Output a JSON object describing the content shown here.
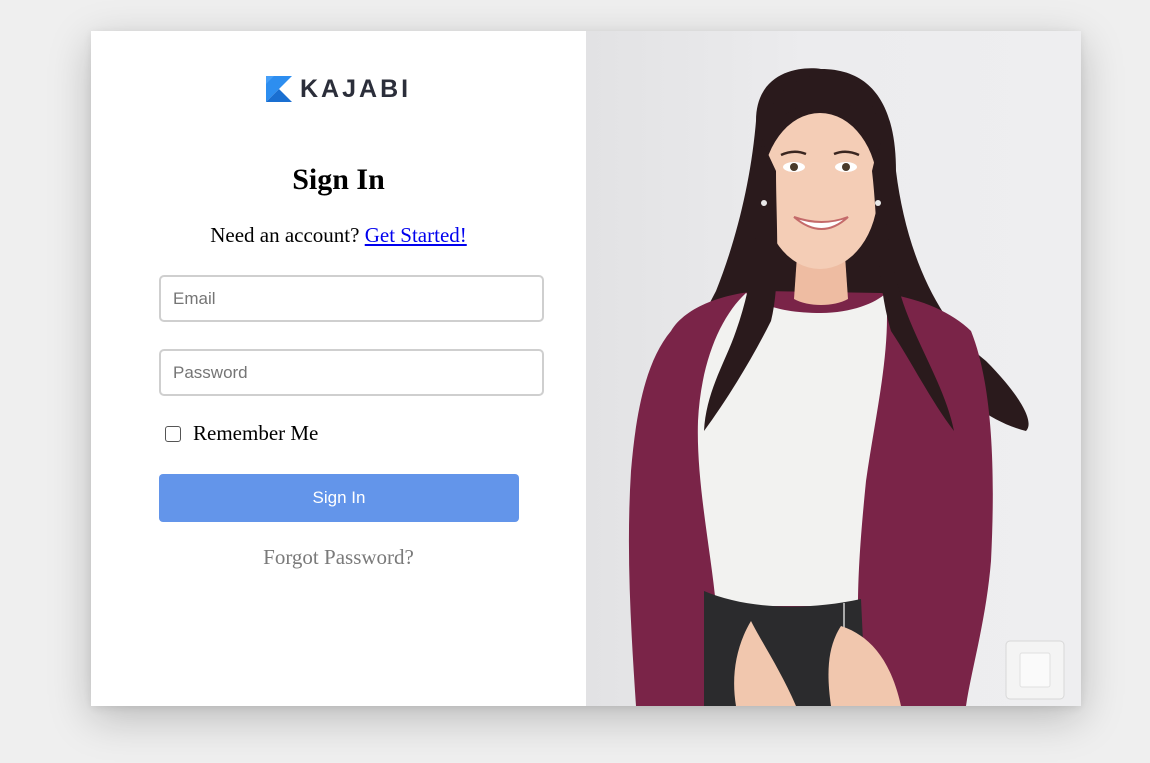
{
  "brand": {
    "name": "KAJABI",
    "accent": "#2d8ef0"
  },
  "signin": {
    "title": "Sign In",
    "need_account_text": "Need an account?",
    "get_started_link": "Get Started!",
    "email_placeholder": "Email",
    "password_placeholder": "Password",
    "remember_label": "Remember Me",
    "remember_checked": false,
    "submit_label": "Sign In",
    "forgot_link": "Forgot Password?"
  },
  "colors": {
    "button_bg": "#6395ea",
    "link": "#0000ee",
    "cardigan": "#7a2448"
  }
}
